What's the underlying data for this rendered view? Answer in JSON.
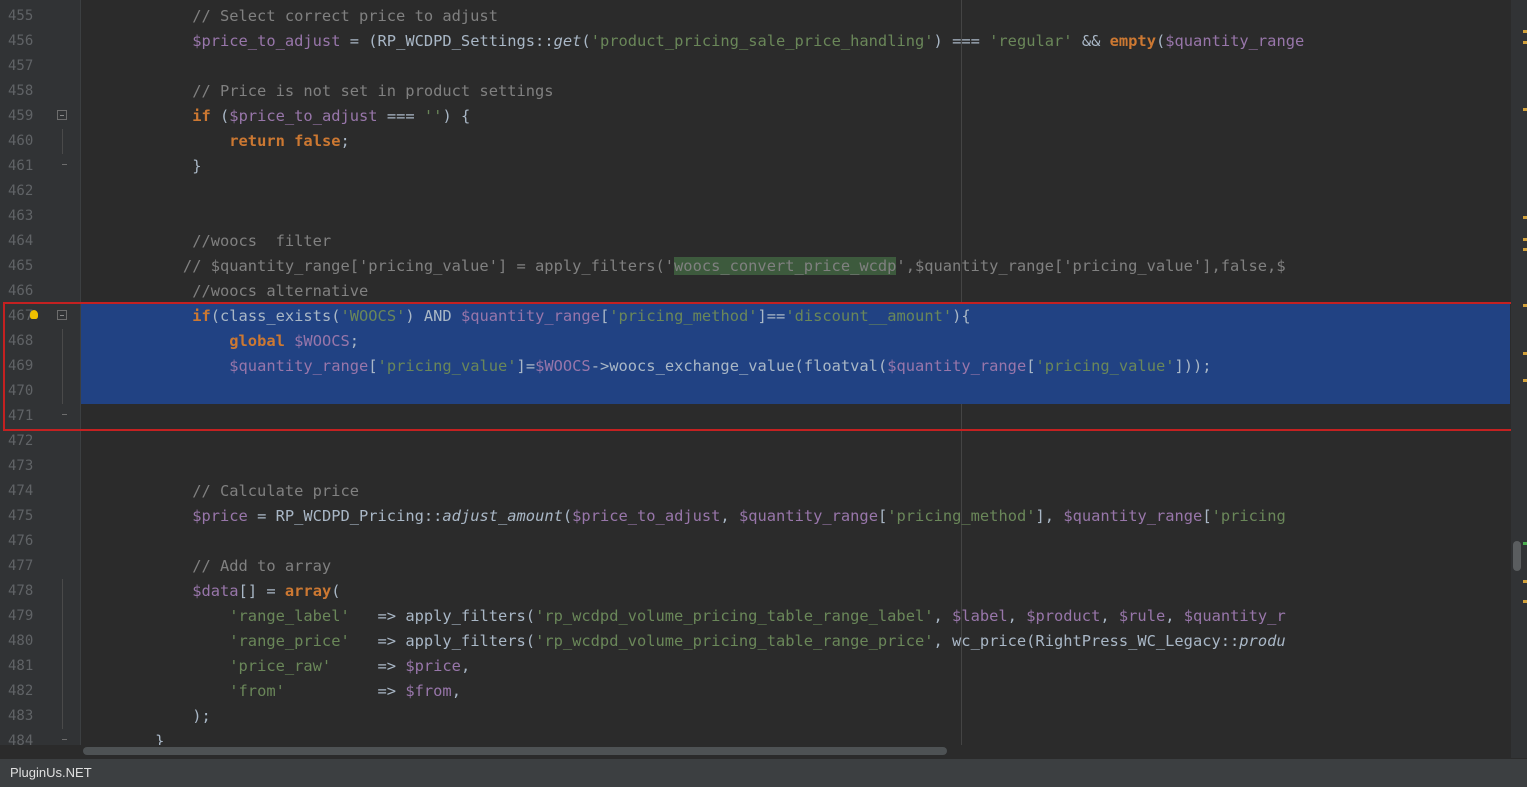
{
  "status_bar": {
    "text": "PluginUs.NET"
  },
  "colors": {
    "selection": "#214283",
    "highlight_box": "#c42121",
    "keyword": "#cc7832",
    "string": "#6a8759",
    "variable": "#9876aa",
    "comment": "#808080"
  },
  "line_numbers": [
    "455",
    "456",
    "457",
    "458",
    "459",
    "460",
    "461",
    "462",
    "463",
    "464",
    "465",
    "466",
    "467",
    "468",
    "469",
    "470",
    "471",
    "472",
    "473",
    "474",
    "475",
    "476",
    "477",
    "478",
    "479",
    "480",
    "481",
    "482",
    "483",
    "484"
  ],
  "code": {
    "l455": [
      "            // Select correct price to adjust"
    ],
    "l456": [
      "            ",
      "$price_to_adjust",
      " = (RP_WCDPD_Settings::",
      "get",
      "(",
      "'product_pricing_sale_price_handling'",
      ") === ",
      "'regular'",
      " && ",
      "empty",
      "(",
      "$quantity_range"
    ],
    "l458": [
      "            // Price is not set in product settings"
    ],
    "l459": [
      "            ",
      "if",
      " (",
      "$price_to_adjust",
      " === ",
      "''",
      ") {"
    ],
    "l460": [
      "                ",
      "return",
      " ",
      "false",
      ";"
    ],
    "l461": [
      "            }"
    ],
    "l464": [
      "            //woocs  filter"
    ],
    "l465": [
      "           // $quantity_range['pricing_value'] = apply_filters('",
      "woocs_convert_price_wcdp",
      "',$quantity_range['pricing_value'],false,$"
    ],
    "l466": [
      "            //woocs alternative"
    ],
    "l467": [
      "            ",
      "if",
      "(class_exists(",
      "'WOOCS'",
      ") AND ",
      "$quantity_range",
      "[",
      "'pricing_method'",
      "]==",
      "'discount__amount'",
      "){"
    ],
    "l468": [
      "                ",
      "global",
      " ",
      "$WOOCS",
      ";"
    ],
    "l469": [
      "                ",
      "$quantity_range",
      "[",
      "'pricing_value'",
      "]=",
      "$WOOCS",
      "->woocs_exchange_value(floatval(",
      "$quantity_range",
      "[",
      "'pricing_value'",
      "]));"
    ],
    "l471": [
      "            }"
    ],
    "l474": [
      "            // Calculate price"
    ],
    "l475": [
      "            ",
      "$price",
      " = RP_WCDPD_Pricing::",
      "adjust_amount",
      "(",
      "$price_to_adjust",
      ", ",
      "$quantity_range",
      "[",
      "'pricing_method'",
      "], ",
      "$quantity_range",
      "[",
      "'pricing"
    ],
    "l477": [
      "            // Add to array"
    ],
    "l478": [
      "            ",
      "$data",
      "[] = ",
      "array",
      "("
    ],
    "l479": [
      "                ",
      "'range_label'",
      "   => apply_filters(",
      "'rp_wcdpd_volume_pricing_table_range_label'",
      ", ",
      "$label",
      ", ",
      "$product",
      ", ",
      "$rule",
      ", ",
      "$quantity_r"
    ],
    "l480": [
      "                ",
      "'range_price'",
      "   => apply_filters(",
      "'rp_wcdpd_volume_pricing_table_range_price'",
      ", wc_price(RightPress_WC_Legacy::",
      "produ"
    ],
    "l481": [
      "                ",
      "'price_raw'",
      "     => ",
      "$price",
      ","
    ],
    "l482": [
      "                ",
      "'from'",
      "          => ",
      "$from",
      ","
    ],
    "l483": [
      "            );"
    ],
    "l484": [
      "        }"
    ]
  }
}
